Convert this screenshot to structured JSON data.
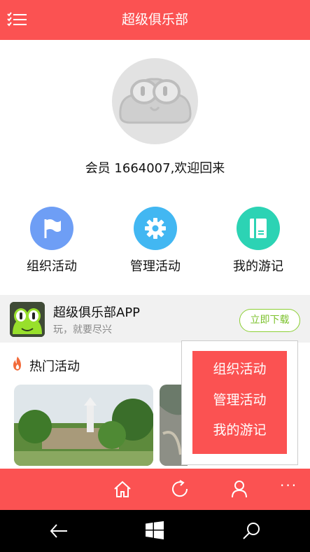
{
  "header": {
    "title": "超级俱乐部",
    "menu_icon": "menu-checklist-icon"
  },
  "profile": {
    "welcome": "会员 1664007,欢迎回来"
  },
  "actions": [
    {
      "label": "组织活动",
      "icon": "flag-icon",
      "color": "#6e9ef5"
    },
    {
      "label": "管理活动",
      "icon": "gear-icon",
      "color": "#42b7f2"
    },
    {
      "label": "我的游记",
      "icon": "notebook-icon",
      "color": "#2cd3b4"
    }
  ],
  "banner": {
    "app_name": "超级俱乐部APP",
    "slogan": "玩，就要尽兴",
    "download": "立即下载"
  },
  "hot": {
    "title": "热门活动"
  },
  "popup": {
    "items": [
      "组织活动",
      "管理活动",
      "我的游记"
    ]
  },
  "bottom_bar": {
    "more": "···"
  },
  "colors": {
    "brand_red": "#fb5252",
    "download_green": "#7cc22c"
  }
}
